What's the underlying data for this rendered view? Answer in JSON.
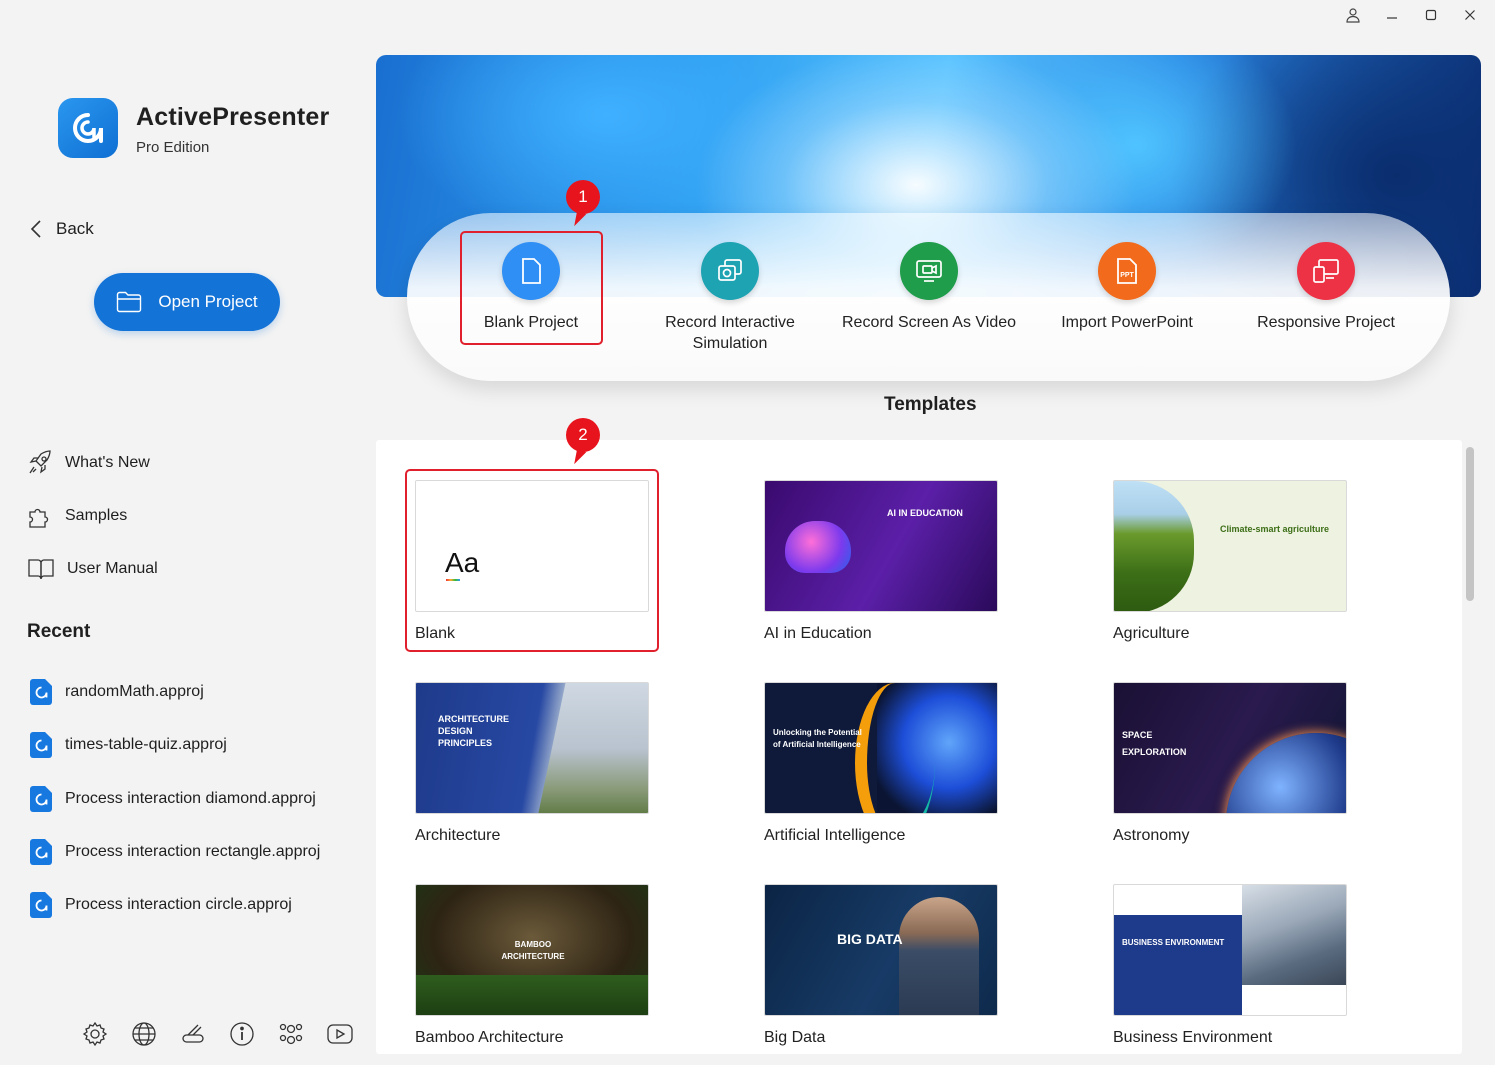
{
  "app": {
    "title": "ActivePresenter",
    "edition": "Pro Edition"
  },
  "nav": {
    "back_label": "Back",
    "open_project_label": "Open Project"
  },
  "links": [
    {
      "label": "What's New",
      "icon": "rocket-icon"
    },
    {
      "label": "Samples",
      "icon": "puzzle-icon"
    },
    {
      "label": "User Manual",
      "icon": "book-icon"
    }
  ],
  "recent": {
    "heading": "Recent",
    "files": [
      "randomMath.approj",
      "times-table-quiz.approj",
      "Process interaction diamond.approj",
      "Process interaction rectangle.approj",
      "Process interaction circle.approj"
    ]
  },
  "bottom_icons": [
    "gear-icon",
    "globe-icon",
    "eraser-icon",
    "info-icon",
    "community-icon",
    "youtube-icon"
  ],
  "window_controls": [
    "user-icon",
    "minimize-icon",
    "maximize-icon",
    "close-icon"
  ],
  "actions": [
    {
      "label": "Blank Project",
      "color": "#2f8ff5",
      "icon": "document-icon"
    },
    {
      "label": "Record Interactive Simulation",
      "color": "#1ea3b3",
      "icon": "camera-icon"
    },
    {
      "label": "Record Screen As Video",
      "color": "#1f9d4a",
      "icon": "video-record-icon"
    },
    {
      "label": "Import PowerPoint",
      "color": "#f26a1b",
      "icon": "ppt-icon"
    },
    {
      "label": "Responsive Project",
      "color": "#ee3245",
      "icon": "responsive-icon"
    }
  ],
  "annotations": [
    "1",
    "2"
  ],
  "templates_heading": "Templates",
  "templates": [
    {
      "name": "Blank",
      "thumb_text": "Aa"
    },
    {
      "name": "AI in Education",
      "thumb_text": "AI IN EDUCATION"
    },
    {
      "name": "Agriculture",
      "thumb_text": "Climate-smart agriculture"
    },
    {
      "name": "Architecture",
      "thumb_text": "ARCHITECTURE DESIGN PRINCIPLES"
    },
    {
      "name": "Artificial Intelligence",
      "thumb_text": "Unlocking the Potential of Artificial Intelligence"
    },
    {
      "name": "Astronomy",
      "thumb_text": "SPACE EXPLORATION"
    },
    {
      "name": "Bamboo Architecture",
      "thumb_text": "BAMBOO ARCHITECTURE"
    },
    {
      "name": "Big Data",
      "thumb_text": "BIG DATA"
    },
    {
      "name": "Business Environment",
      "thumb_text": "BUSINESS ENVIRONMENT"
    }
  ]
}
